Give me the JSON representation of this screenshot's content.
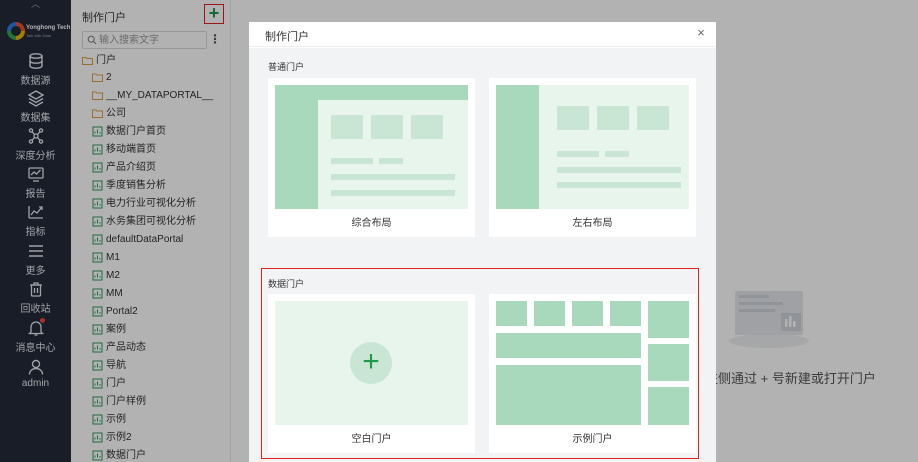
{
  "nav": {
    "logo_brand": "Yonghong Tech",
    "logo_tag": "Talk with Data",
    "items": [
      {
        "label": "数据源",
        "icon": "database-icon"
      },
      {
        "label": "数据集",
        "icon": "layers-icon"
      },
      {
        "label": "深度分析",
        "icon": "network-icon"
      },
      {
        "label": "报告",
        "icon": "chart-report-icon"
      },
      {
        "label": "指标",
        "icon": "metric-trend-icon"
      },
      {
        "label": "更多",
        "icon": "menu-icon"
      },
      {
        "label": "回收站",
        "icon": "trash-icon"
      },
      {
        "label": "消息中心",
        "icon": "bell-icon"
      },
      {
        "label": "admin",
        "icon": "user-icon"
      }
    ]
  },
  "tree": {
    "title": "制作门户",
    "add_label": "+",
    "search_placeholder": "输入搜索文字",
    "more_label": "⋮",
    "root": "门户",
    "folders": [
      "2",
      "__MY_DATAPORTAL__",
      "公司"
    ],
    "items": [
      "数据门户首页",
      "移动端首页",
      "产品介绍页",
      "季度销售分析",
      "电力行业可视化分析",
      "水务集团可视化分析",
      "defaultDataPortal",
      "M1",
      "M2",
      "MM",
      "Portal2",
      "案例",
      "产品动态",
      "导航",
      "门户",
      "门户样例",
      "示例",
      "示例2",
      "数据门户"
    ]
  },
  "workspace": {
    "empty_hint": "左侧通过 + 号新建或打开门户"
  },
  "modal": {
    "title": "制作门户",
    "close_label": "×",
    "normal_section": "普通门户",
    "data_section": "数据门户",
    "cards": {
      "composite": "综合布局",
      "left_right": "左右布局",
      "blank": "空白门户",
      "example": "示例门户"
    },
    "plus_label": "+"
  },
  "colors": {
    "nav_bg": "#232a3a",
    "accent_green": "#1d9a4c",
    "selection_red": "#e02020",
    "preview_block": "#a9d9bd",
    "preview_bg": "#e8f5ec"
  }
}
